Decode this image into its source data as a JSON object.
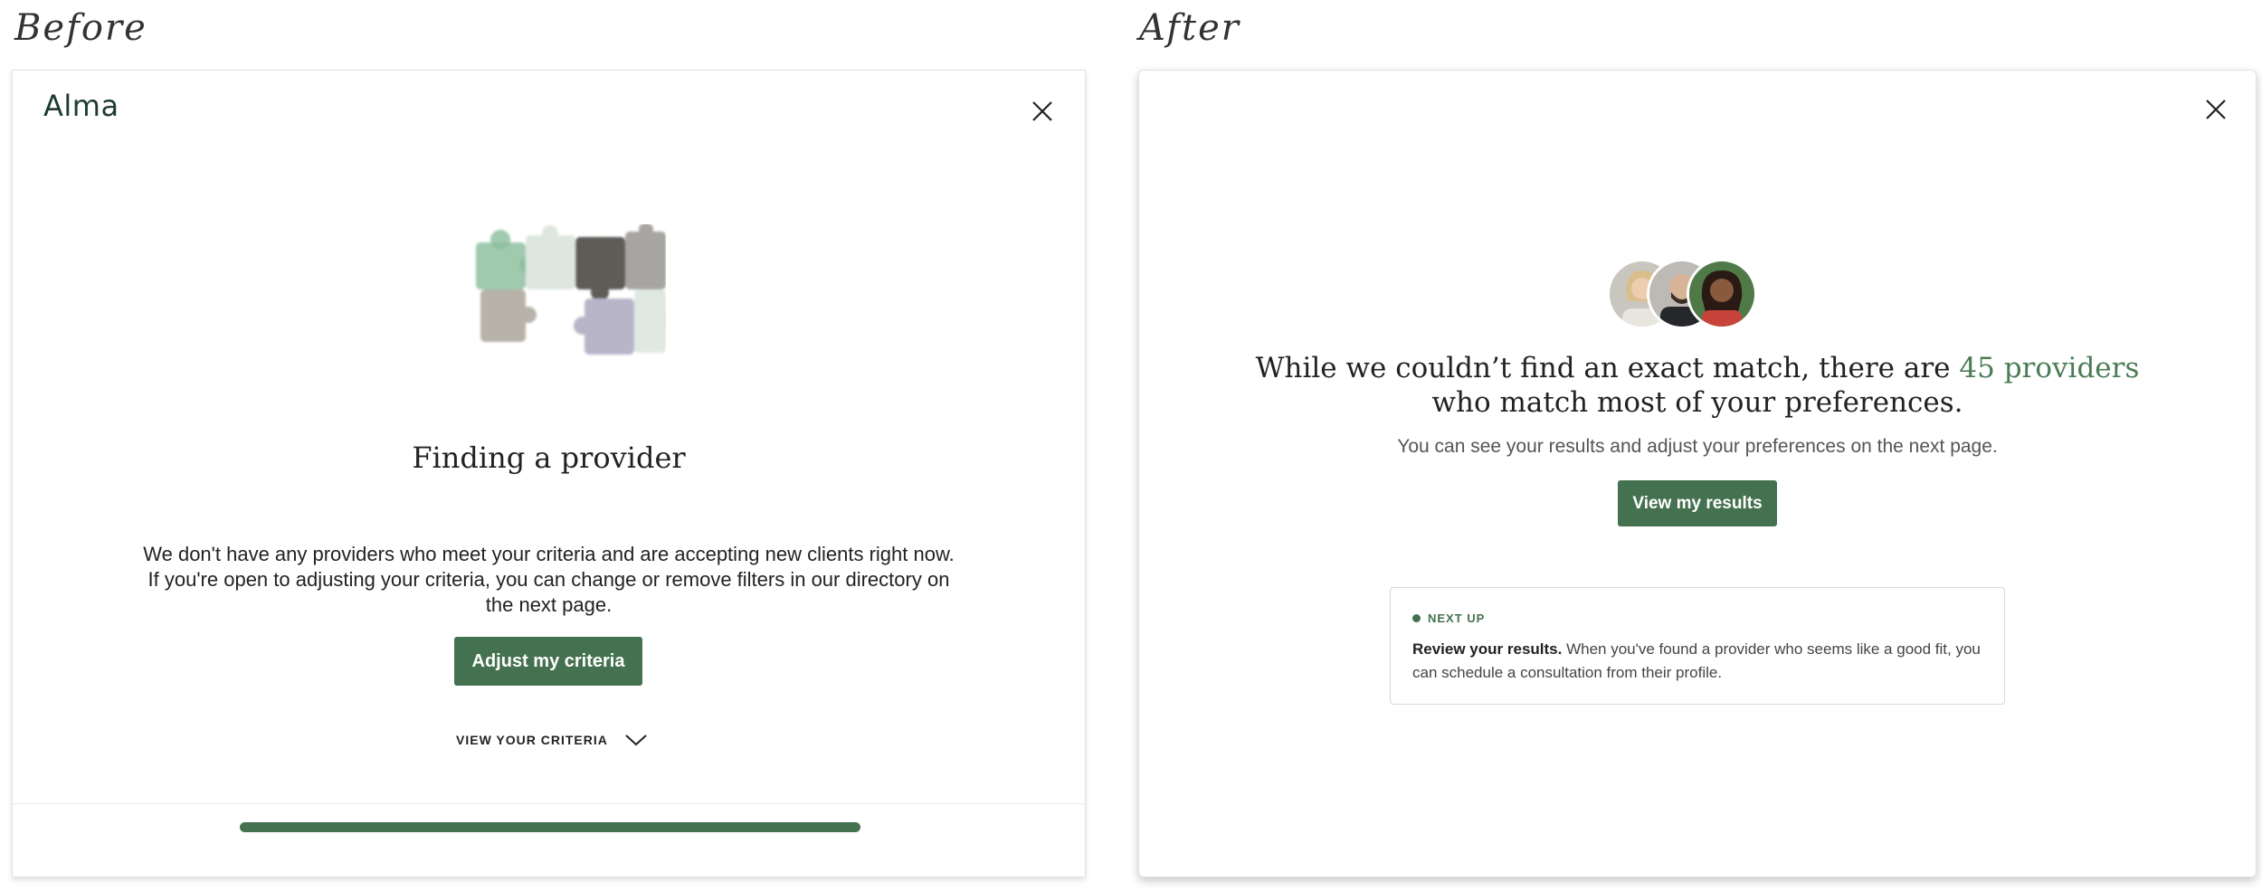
{
  "labels": {
    "before": "Before",
    "after": "After"
  },
  "before": {
    "logo": "Alma",
    "heading": "Finding a provider",
    "body_line1": "We don't have any providers who meet your criteria and are accepting new clients right now.",
    "body_line2": "If you're open to adjusting your criteria, you can change or remove filters in our directory on",
    "body_line3": "the next page.",
    "button": "Adjust my criteria",
    "view_criteria": "VIEW YOUR CRITERIA",
    "progress": 1.0
  },
  "after": {
    "headline_pre": "While we couldn’t find an exact match, there are ",
    "headline_highlight": "45 providers",
    "headline_line2": "who match most of your preferences.",
    "subtext": "You can see your results and adjust your preferences on the next page.",
    "button": "View my results",
    "card": {
      "badge": "NEXT UP",
      "title": "Review your results.",
      "text_line1": "When you've found a provider who seems like a good fit, you",
      "text_line2": "can schedule a consultation from their profile."
    }
  },
  "colors": {
    "accent": "#44714f",
    "logo": "#1e3b2f",
    "highlight": "#4a7c55"
  },
  "icons": [
    "close-icon",
    "puzzle-illustration",
    "chevron-down-icon",
    "avatar-image",
    "status-dot-icon"
  ]
}
